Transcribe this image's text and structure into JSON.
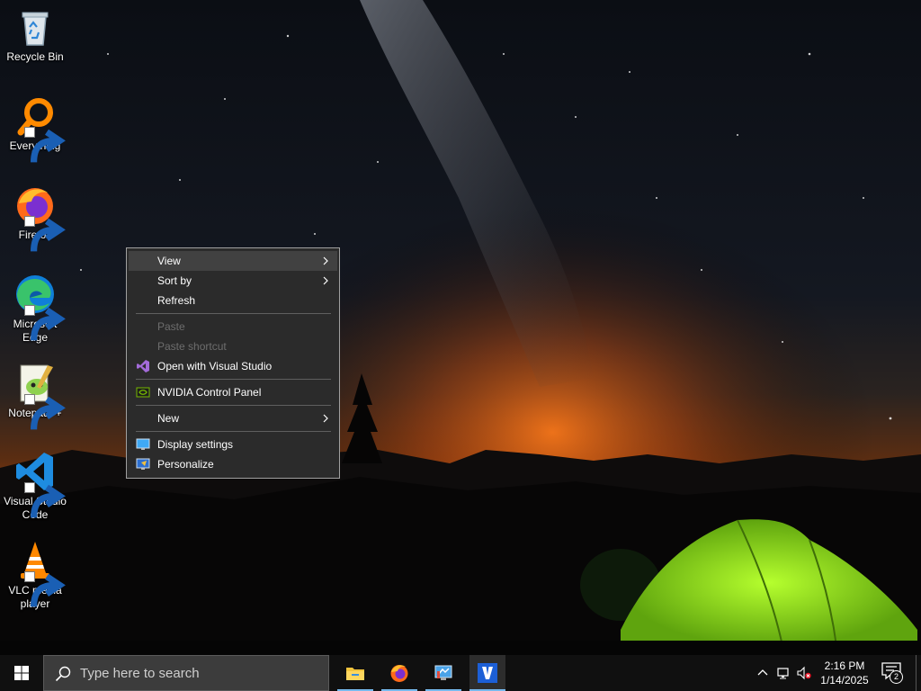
{
  "desktop": {
    "icons": [
      {
        "label": "Recycle Bin",
        "icon": "recycle-bin-icon",
        "shortcut": false
      },
      {
        "label": "Everything",
        "icon": "everything-search-icon",
        "shortcut": true
      },
      {
        "label": "Firefox",
        "icon": "firefox-icon",
        "shortcut": true
      },
      {
        "label": "Microsoft Edge",
        "icon": "edge-icon",
        "shortcut": true
      },
      {
        "label": "Notepad++",
        "icon": "notepad-plus-plus-icon",
        "shortcut": true
      },
      {
        "label": "Visual Studio Code",
        "icon": "vscode-icon",
        "shortcut": true
      },
      {
        "label": "VLC media player",
        "icon": "vlc-icon",
        "shortcut": true
      }
    ]
  },
  "context_menu": {
    "items": [
      {
        "label": "View",
        "submenu": true,
        "enabled": true,
        "hovered": true
      },
      {
        "label": "Sort by",
        "submenu": true,
        "enabled": true
      },
      {
        "label": "Refresh",
        "enabled": true
      },
      {
        "label": "Paste",
        "enabled": false
      },
      {
        "label": "Paste shortcut",
        "enabled": false
      },
      {
        "label": "Open with Visual Studio",
        "enabled": true,
        "icon": "visual-studio-icon"
      },
      {
        "label": "NVIDIA Control Panel",
        "enabled": true,
        "icon": "nvidia-icon"
      },
      {
        "label": "New",
        "submenu": true,
        "enabled": true
      },
      {
        "label": "Display settings",
        "enabled": true,
        "icon": "display-settings-icon"
      },
      {
        "label": "Personalize",
        "enabled": true,
        "icon": "personalize-icon"
      }
    ]
  },
  "taskbar": {
    "search_placeholder": "Type here to search",
    "pinned": [
      "file-explorer-icon",
      "firefox-icon",
      "control-panel-icon",
      "v-app-icon"
    ],
    "clock": {
      "time": "2:16 PM",
      "date": "1/14/2025"
    },
    "notification_count": "2"
  },
  "colors": {
    "menu_bg": "#2b2b2b",
    "menu_hover": "#414141",
    "taskbar_bg": "#101010",
    "accent": "#76b9ed"
  }
}
